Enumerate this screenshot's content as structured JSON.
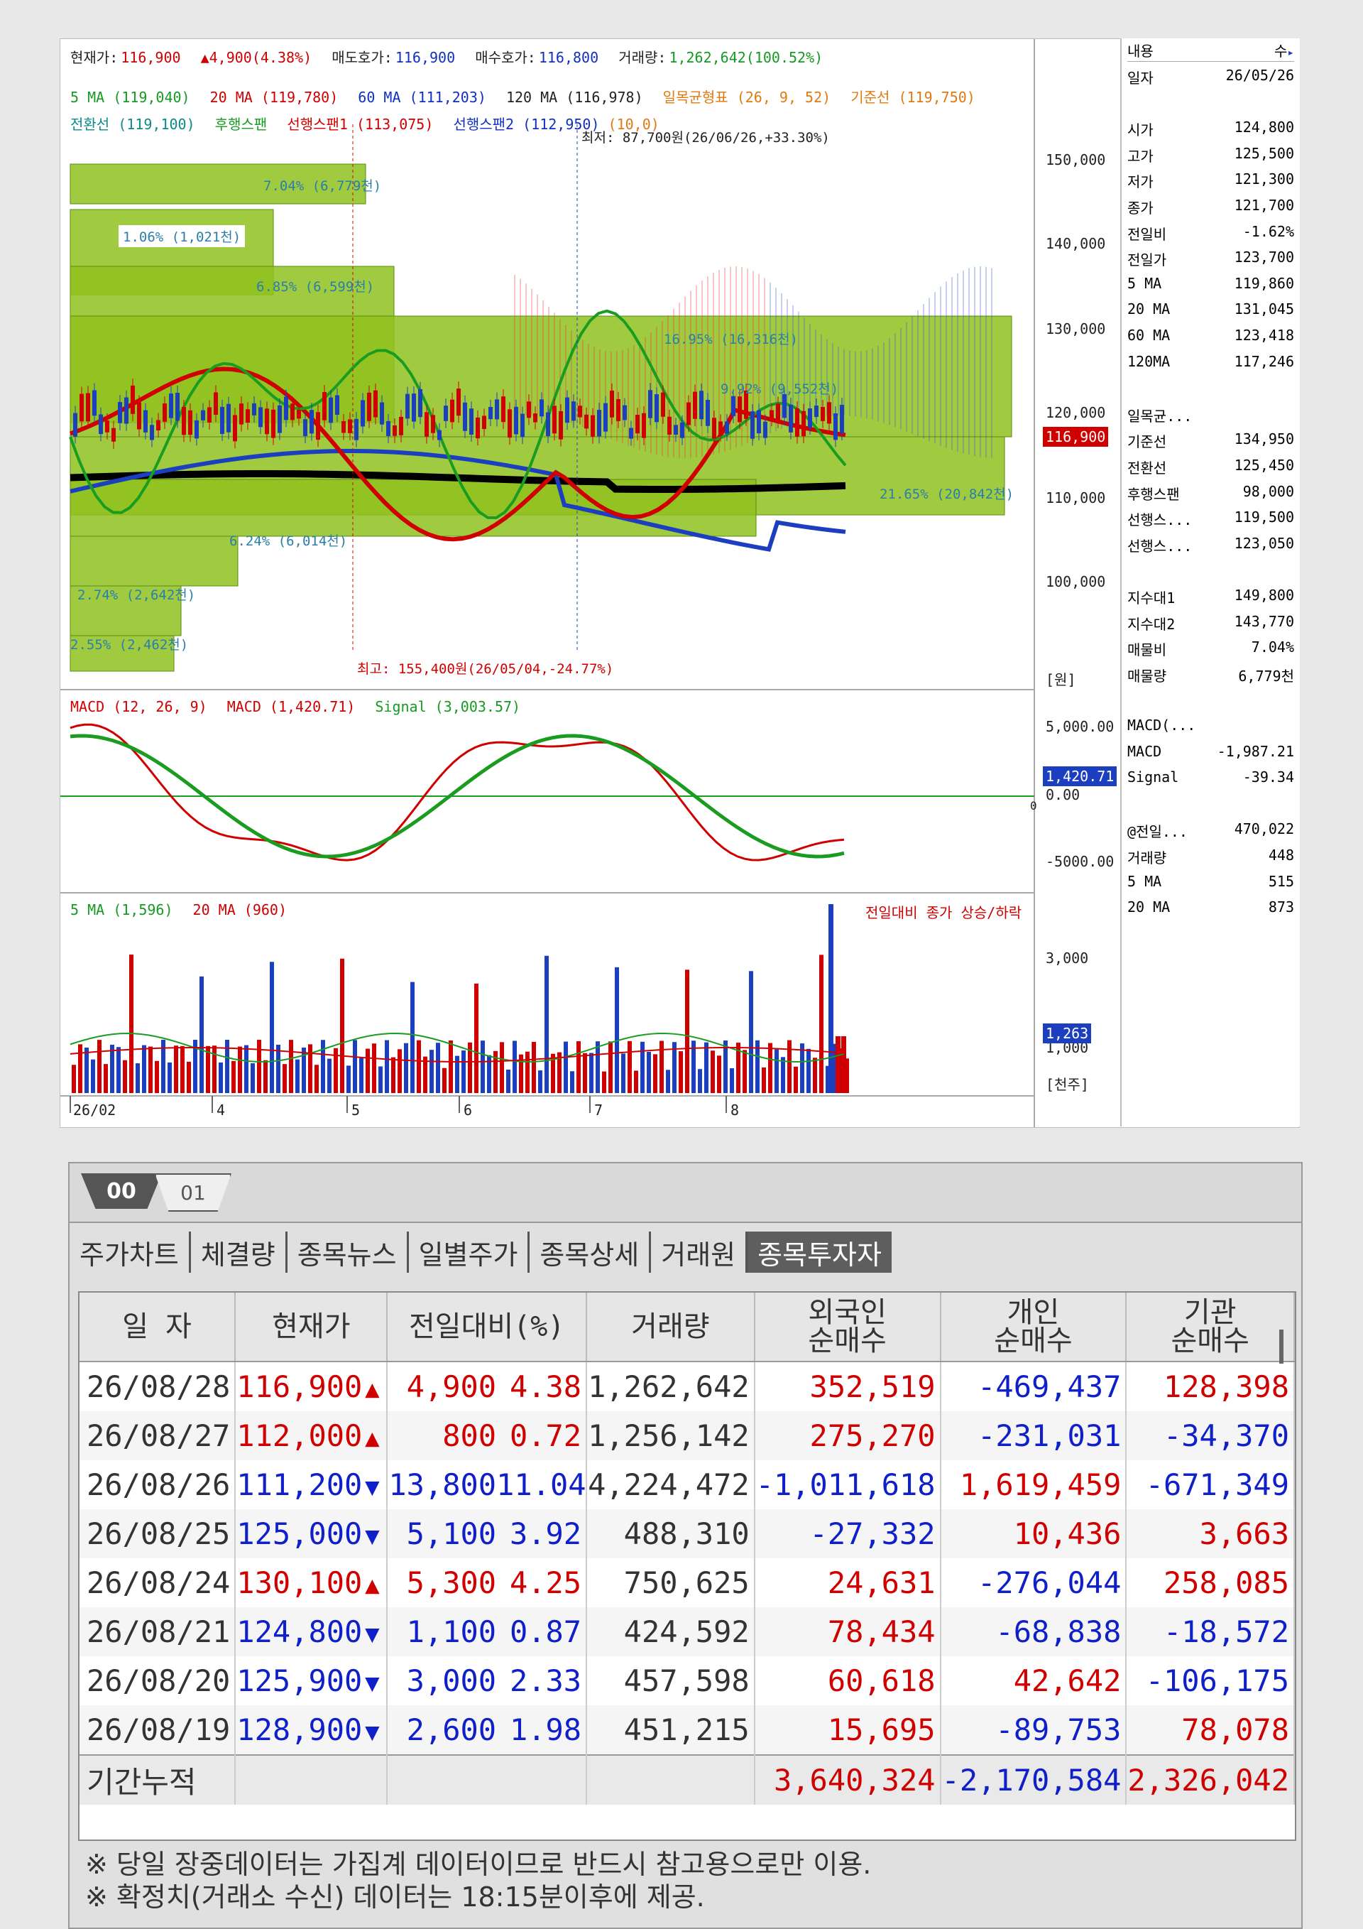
{
  "header": {
    "current_label": "현재가:",
    "current_value": "116,900",
    "change_value": "▲4,900(4.38%)",
    "ask_label": "매도호가:",
    "ask_value": "116,900",
    "bid_label": "매수호가:",
    "bid_value": "116,800",
    "volume_label": "거래량:",
    "volume_value": "1,262,642(100.52%)"
  },
  "legend_price": {
    "ma5": "5 MA (119,040)",
    "ma20": "20 MA (119,780)",
    "ma60": "60 MA (111,203)",
    "ma120": "120 MA (116,978)",
    "ichimoku": "일목균형표 (26, 9, 52)",
    "base_line": "기준선 (119,750)",
    "conv_line": "전환선 (119,100)",
    "lagging": "후행스팬",
    "lead1": "선행스팬1 (113,075)",
    "lead2": "선행스팬2 (112,950)",
    "lead2_extra": "(10,0)",
    "low_label": "최저: 87,700원(26/06/26,+33.30%)",
    "high_label": "최고: 155,400원(26/05/04,-24.77%)"
  },
  "price_axis": [
    "150,000",
    "140,000",
    "130,000",
    "120,000",
    "110,000",
    "100,000"
  ],
  "price_unit": "[원]",
  "current_price_tag": "116,900",
  "volume_profile": [
    "7.04% (6,779천)",
    "1.06% (1,021천)",
    "6.85% (6,599천)",
    "16.95% (16,316천)",
    "9.92% (9,552천)",
    "21.65% (20,842천)",
    "6.24% (6,014천)",
    "2.74% (2,642천)",
    "2.55% (2,462천)"
  ],
  "macd_legend": {
    "macd_label": "MACD (12, 26, 9)",
    "macd_val": "MACD (1,420.71)",
    "signal_val": "Signal (3,003.57)"
  },
  "macd_axis": [
    "5,000.00",
    "0.00",
    "-5000.00"
  ],
  "macd_tag": "1,420.71",
  "macd_zero": "0",
  "volume_legend": {
    "ma5": "5 MA (1,596)",
    "ma20": "20 MA (960)",
    "note": "전일대비 종가 상승/하락"
  },
  "volume_axis": [
    "3,000",
    "1,000"
  ],
  "volume_tag": "1,263",
  "volume_unit": "[천주]",
  "x_axis": [
    "26/02",
    "4",
    "5",
    "6",
    "7",
    "8"
  ],
  "side": {
    "header_left": "내용",
    "header_right": "수",
    "rows": [
      [
        "일자",
        "26/05/26"
      ],
      [
        "",
        ""
      ],
      [
        "시가",
        "124,800"
      ],
      [
        "고가",
        "125,500"
      ],
      [
        "저가",
        "121,300"
      ],
      [
        "종가",
        "121,700"
      ],
      [
        "전일비",
        "-1.62%"
      ],
      [
        "전일가",
        "123,700"
      ],
      [
        "5 MA",
        "119,860"
      ],
      [
        "20 MA",
        "131,045"
      ],
      [
        "60 MA",
        "123,418"
      ],
      [
        "120MA",
        "117,246"
      ],
      [
        "",
        ""
      ],
      [
        "일목균...",
        ""
      ],
      [
        "기준선",
        "134,950"
      ],
      [
        "전환선",
        "125,450"
      ],
      [
        "후행스팬",
        "98,000"
      ],
      [
        "선행스...",
        "119,500"
      ],
      [
        "선행스...",
        "123,050"
      ],
      [
        "",
        ""
      ],
      [
        "지수대1",
        "149,800"
      ],
      [
        "지수대2",
        "143,770"
      ],
      [
        "매물비",
        "7.04%"
      ],
      [
        "매물량",
        "6,779천"
      ],
      [
        "",
        ""
      ],
      [
        "MACD(...",
        ""
      ],
      [
        "MACD",
        "-1,987.21"
      ],
      [
        "Signal",
        "-39.34"
      ],
      [
        "",
        ""
      ],
      [
        "@전일...",
        "470,022"
      ],
      [
        "거래량",
        "448"
      ],
      [
        "5 MA",
        "515"
      ],
      [
        "20 MA",
        "873"
      ]
    ]
  },
  "table": {
    "tab00": "00",
    "tab01": "01",
    "nav": [
      "주가차트",
      "체결량",
      "종목뉴스",
      "일별주가",
      "종목상세",
      "거래원",
      "종목투자자"
    ],
    "columns": [
      "일 자",
      "현재가",
      "전일대비(%)",
      "거래량",
      "외국인\n순매수",
      "개인\n순매수",
      "기관\n순매수"
    ],
    "rows": [
      {
        "date": "26/08/28",
        "price": "116,900",
        "dir": "up",
        "chg": "4,900",
        "pct": "4.38",
        "vol": "1,262,642",
        "foreign": "352,519",
        "indiv": "-469,437",
        "inst": "128,398"
      },
      {
        "date": "26/08/27",
        "price": "112,000",
        "dir": "up",
        "chg": "800",
        "pct": "0.72",
        "vol": "1,256,142",
        "foreign": "275,270",
        "indiv": "-231,031",
        "inst": "-34,370"
      },
      {
        "date": "26/08/26",
        "price": "111,200",
        "dir": "down",
        "chg": "13,800",
        "pct": "11.04",
        "vol": "4,224,472",
        "foreign": "-1,011,618",
        "indiv": "1,619,459",
        "inst": "-671,349"
      },
      {
        "date": "26/08/25",
        "price": "125,000",
        "dir": "down",
        "chg": "5,100",
        "pct": "3.92",
        "vol": "488,310",
        "foreign": "-27,332",
        "indiv": "10,436",
        "inst": "3,663"
      },
      {
        "date": "26/08/24",
        "price": "130,100",
        "dir": "up",
        "chg": "5,300",
        "pct": "4.25",
        "vol": "750,625",
        "foreign": "24,631",
        "indiv": "-276,044",
        "inst": "258,085"
      },
      {
        "date": "26/08/21",
        "price": "124,800",
        "dir": "down",
        "chg": "1,100",
        "pct": "0.87",
        "vol": "424,592",
        "foreign": "78,434",
        "indiv": "-68,838",
        "inst": "-18,572"
      },
      {
        "date": "26/08/20",
        "price": "125,900",
        "dir": "down",
        "chg": "3,000",
        "pct": "2.33",
        "vol": "457,598",
        "foreign": "60,618",
        "indiv": "42,642",
        "inst": "-106,175"
      },
      {
        "date": "26/08/19",
        "price": "128,900",
        "dir": "down",
        "chg": "2,600",
        "pct": "1.98",
        "vol": "451,215",
        "foreign": "15,695",
        "indiv": "-89,753",
        "inst": "78,078"
      }
    ],
    "total_label": "기간누적",
    "total_foreign": "3,640,324",
    "total_indiv": "-2,170,584",
    "total_inst": "2,326,042",
    "note1": "※ 당일 장중데이터는 가집계 데이터이므로 반드시 참고용으로만 이용.",
    "note2": "※ 확정치(거래소 수신) 데이터는 18:15분이후에 제공."
  }
}
